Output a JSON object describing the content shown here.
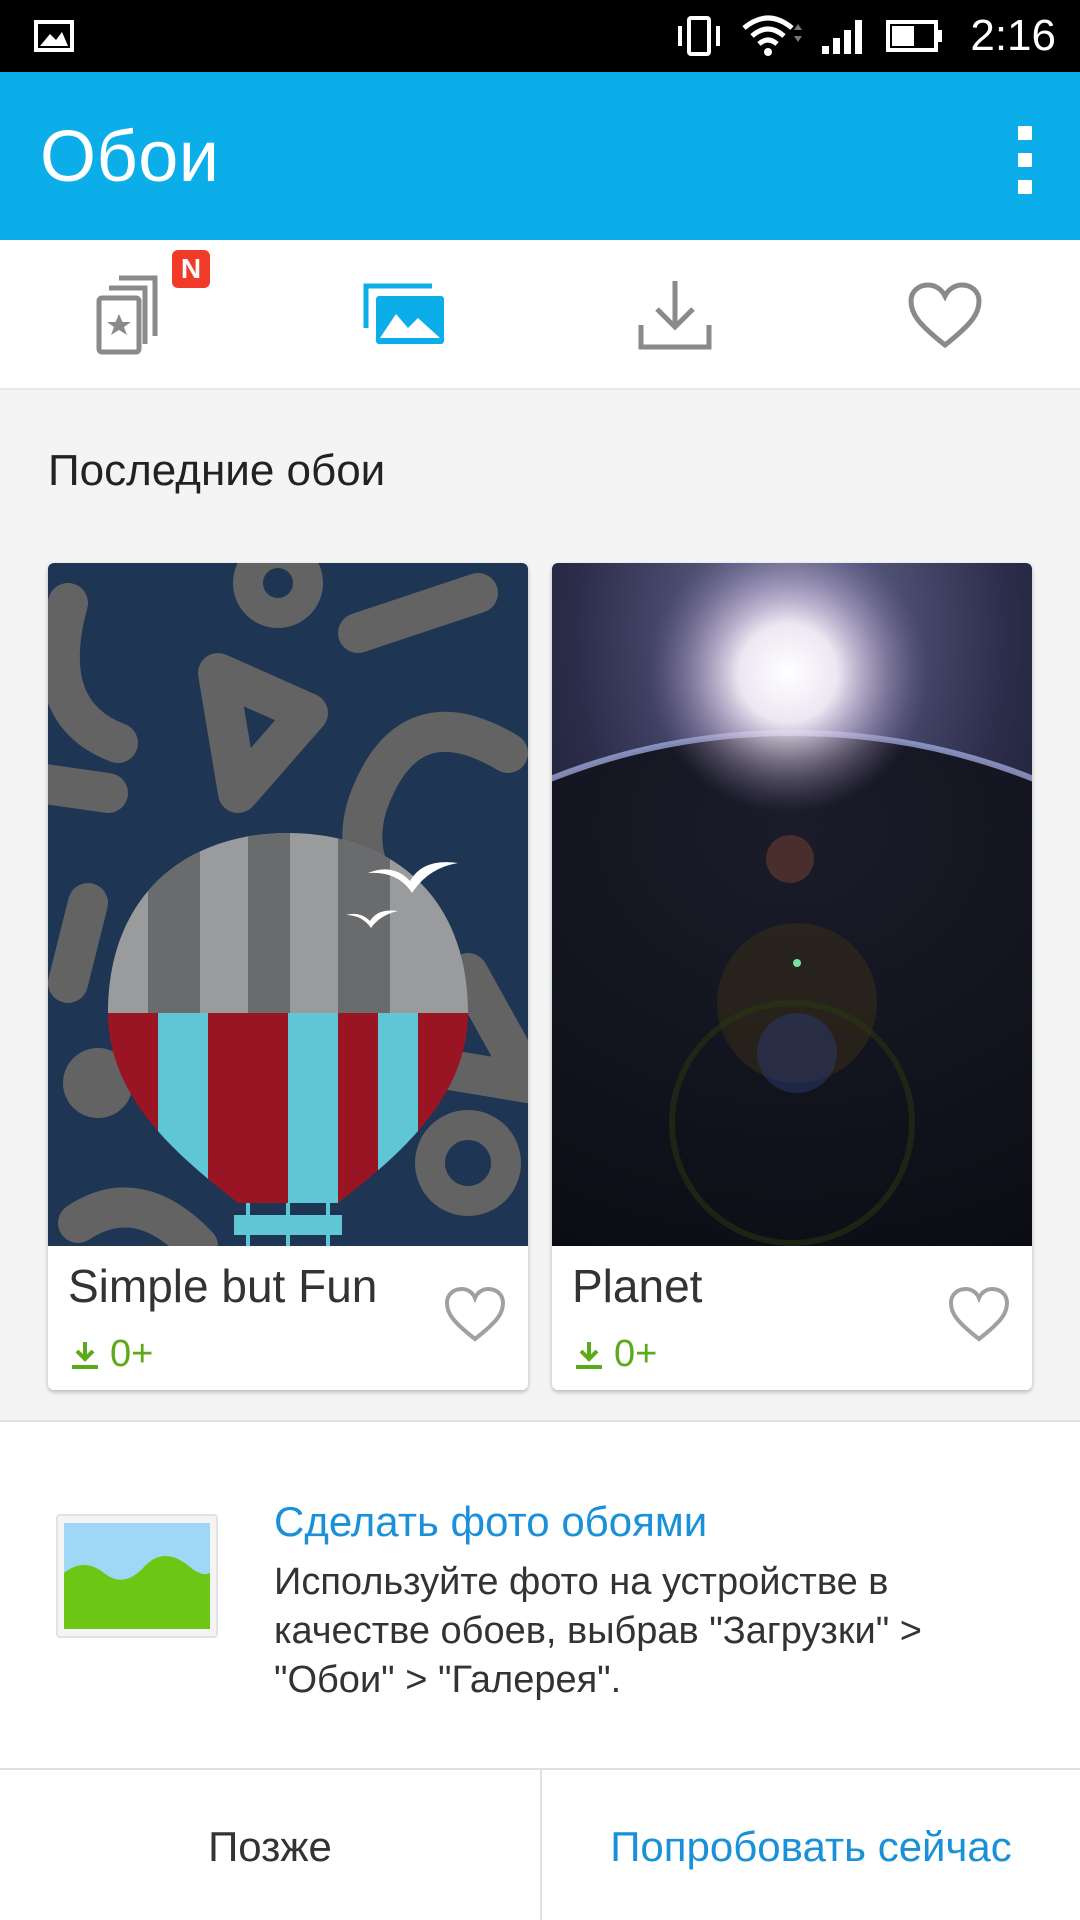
{
  "status_bar": {
    "time": "2:16",
    "icons": [
      "image-notification-icon",
      "vibrate-icon",
      "wifi-icon",
      "signal-icon",
      "battery-icon"
    ]
  },
  "app_bar": {
    "title": "Обои",
    "menu_icon": "overflow-menu-icon"
  },
  "tabs": [
    {
      "icon": "themes-store-icon",
      "badge": "N",
      "active": false
    },
    {
      "icon": "wallpapers-icon",
      "active": true
    },
    {
      "icon": "download-icon",
      "active": false
    },
    {
      "icon": "favorite-icon",
      "active": false
    }
  ],
  "section": {
    "title": "Последние обои"
  },
  "wallpapers": [
    {
      "title": "Simple but Fun",
      "downloads": "0+"
    },
    {
      "title": "Planet",
      "downloads": "0+"
    }
  ],
  "prompt": {
    "title": "Сделать фото обоями",
    "body": "Используйте фото на устройстве в качестве обоев, выбрав \"Загрузки\" > \"Обои\" > \"Галерея\".",
    "later_label": "Позже",
    "try_label": "Попробовать сейчас"
  },
  "colors": {
    "accent": "#0caeea",
    "link": "#1a90d8",
    "download_green": "#5aaa19",
    "badge_red": "#f03b28"
  }
}
